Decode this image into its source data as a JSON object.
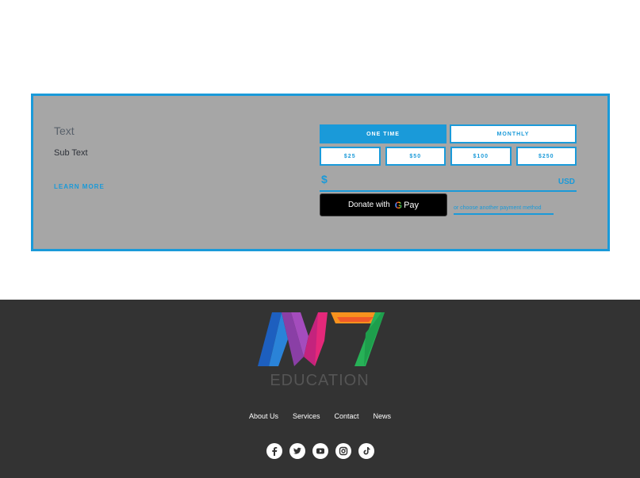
{
  "donation": {
    "title": "Text",
    "subtext": "Sub Text",
    "learn_more": "LEARN MORE",
    "frequency": [
      {
        "label": "ONE TIME",
        "active": true
      },
      {
        "label": "MONTHLY",
        "active": false
      }
    ],
    "amounts": [
      "$25",
      "$50",
      "$100",
      "$250"
    ],
    "currency_sign": "$",
    "currency_code": "USD",
    "gpay_prefix": "Donate with",
    "gpay_g": "G",
    "gpay_pay": "Pay",
    "other_method": "or choose another payment method"
  },
  "footer": {
    "logo_text": "EDUCATION",
    "nav": [
      "About Us",
      "Services",
      "Contact",
      "News"
    ],
    "social_icons": [
      "facebook-icon",
      "twitter-icon",
      "youtube-icon",
      "instagram-icon",
      "tiktok-icon"
    ]
  },
  "colors": {
    "accent": "#1a9ad9",
    "panel": "#a6a6a6",
    "footer_bg": "#333333"
  }
}
